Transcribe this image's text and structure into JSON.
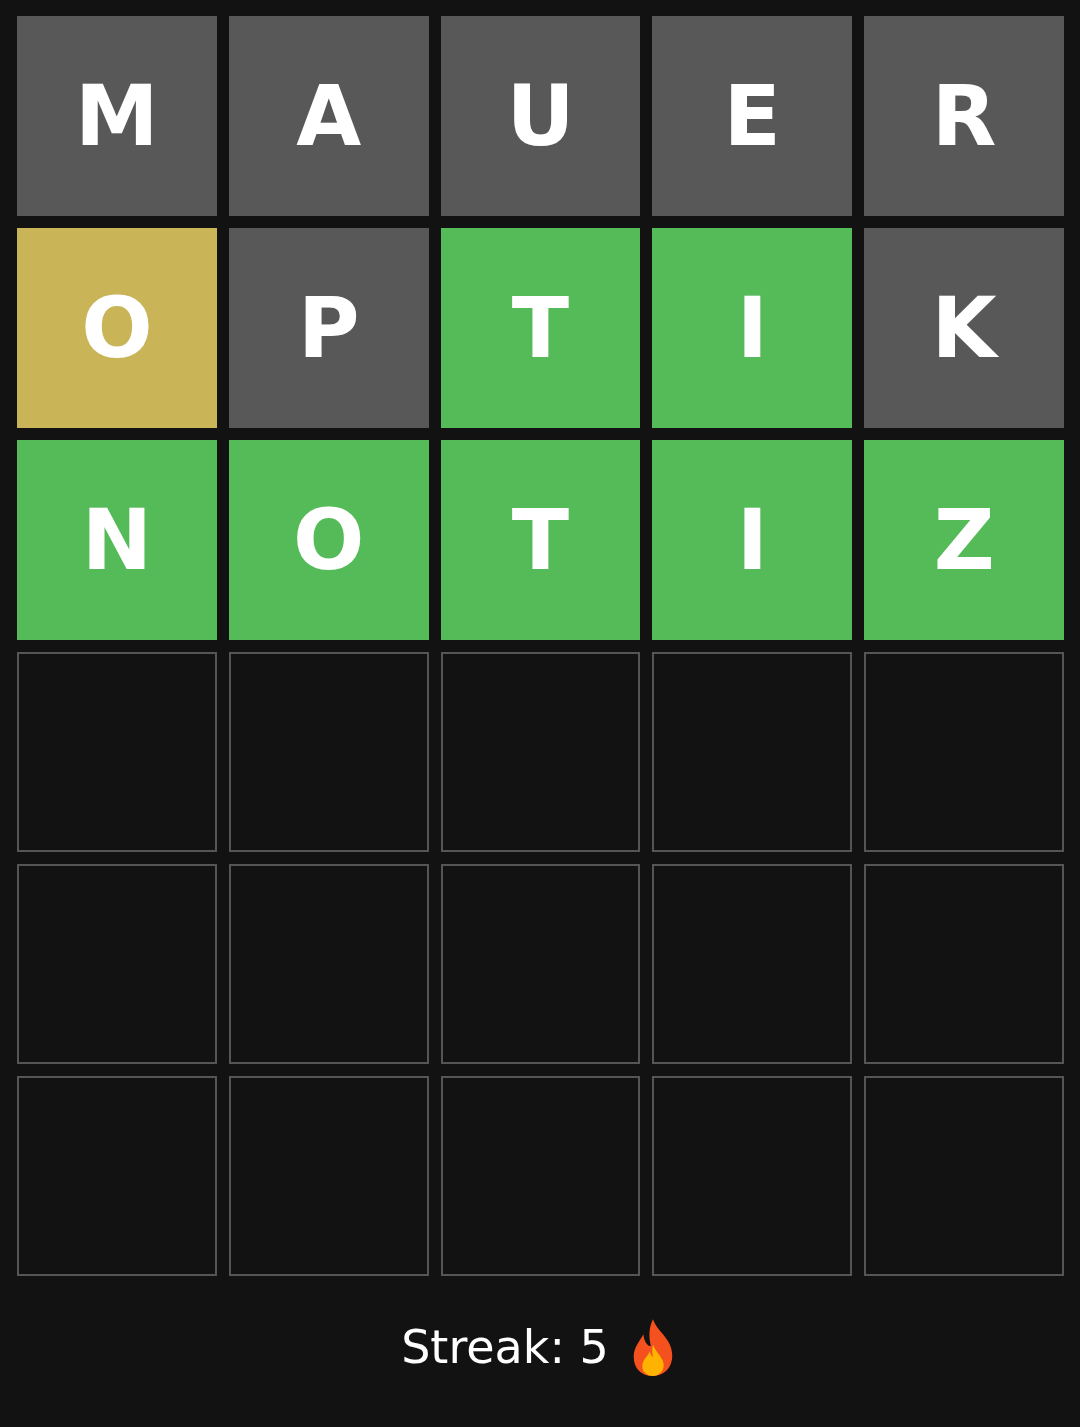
{
  "board": [
    {
      "tiles": [
        {
          "letter": "M",
          "kind": "absent"
        },
        {
          "letter": "A",
          "kind": "absent"
        },
        {
          "letter": "U",
          "kind": "absent"
        },
        {
          "letter": "E",
          "kind": "absent"
        },
        {
          "letter": "R",
          "kind": "absent"
        }
      ]
    },
    {
      "tiles": [
        {
          "letter": "O",
          "kind": "present"
        },
        {
          "letter": "P",
          "kind": "absent"
        },
        {
          "letter": "T",
          "kind": "correct"
        },
        {
          "letter": "I",
          "kind": "correct"
        },
        {
          "letter": "K",
          "kind": "absent"
        }
      ]
    },
    {
      "tiles": [
        {
          "letter": "N",
          "kind": "correct"
        },
        {
          "letter": "O",
          "kind": "correct"
        },
        {
          "letter": "T",
          "kind": "correct"
        },
        {
          "letter": "I",
          "kind": "correct"
        },
        {
          "letter": "Z",
          "kind": "correct"
        }
      ]
    },
    {
      "tiles": [
        {
          "kind": "empty"
        },
        {
          "kind": "empty"
        },
        {
          "kind": "empty"
        },
        {
          "kind": "empty"
        },
        {
          "kind": "empty"
        }
      ]
    },
    {
      "tiles": [
        {
          "kind": "empty"
        },
        {
          "kind": "empty"
        },
        {
          "kind": "empty"
        },
        {
          "kind": "empty"
        },
        {
          "kind": "empty"
        }
      ]
    },
    {
      "tiles": [
        {
          "kind": "empty"
        },
        {
          "kind": "empty"
        },
        {
          "kind": "empty"
        },
        {
          "kind": "empty"
        },
        {
          "kind": "empty"
        }
      ]
    }
  ],
  "streak": {
    "label": "Streak: 5"
  }
}
